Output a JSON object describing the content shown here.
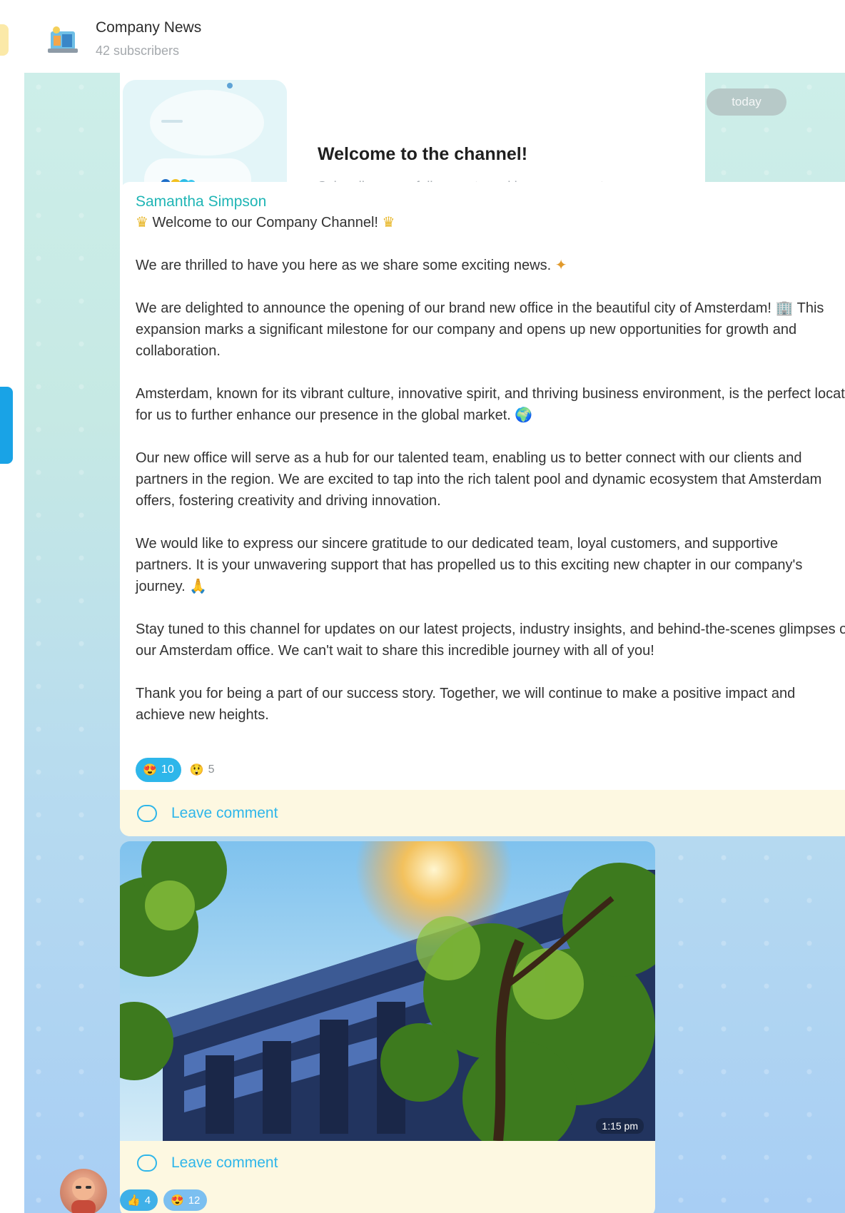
{
  "header": {
    "title": "Company News",
    "subscribers": "42 subscribers"
  },
  "welcome": {
    "title": "Welcome to the channel!",
    "text": "Subscribers can follow posts and leave comments",
    "date_pill": "today"
  },
  "post": {
    "author": "Samantha Simpson",
    "paragraphs": [
      "Welcome to our Company Channel!",
      "We are thrilled to have you here as we share some exciting news.",
      "We are delighted to announce the opening of our brand new office in the beautiful city of Amsterdam! 🏢 This expansion marks a significant milestone for our company and opens up new opportunities for growth and collaboration.",
      "Amsterdam, known for its vibrant culture, innovative spirit, and thriving business environment, is the perfect location for us to further enhance our presence in the global market. 🌍",
      "Our new office will serve as a hub for our talented team, enabling us to better connect with our clients and partners in the region. We are excited to tap into the rich talent pool and dynamic ecosystem that Amsterdam offers, fostering creativity and driving innovation.",
      "We would like to express our sincere gratitude to our dedicated team, loyal customers, and supportive partners. It is your unwavering support that has propelled us to this exciting new chapter in our company's journey. 🙏",
      "Stay tuned to this channel for updates on our latest projects, industry insights, and behind-the-scenes glimpses of our Amsterdam office. We can't wait to share this incredible journey with all of you!",
      "Thank you for being a part of our success story. Together, we will continue to make a positive impact and achieve new heights."
    ],
    "reactions": [
      {
        "emoji": "😍",
        "count": "10"
      },
      {
        "emoji": "😲",
        "count": "5"
      }
    ],
    "comment_label": "Leave comment"
  },
  "photo_post": {
    "time": "1:15 pm",
    "comment_label": "Leave comment"
  },
  "bottom_reactions": [
    {
      "emoji": "👍",
      "count": "4"
    },
    {
      "emoji": "😍",
      "count": "12"
    }
  ]
}
